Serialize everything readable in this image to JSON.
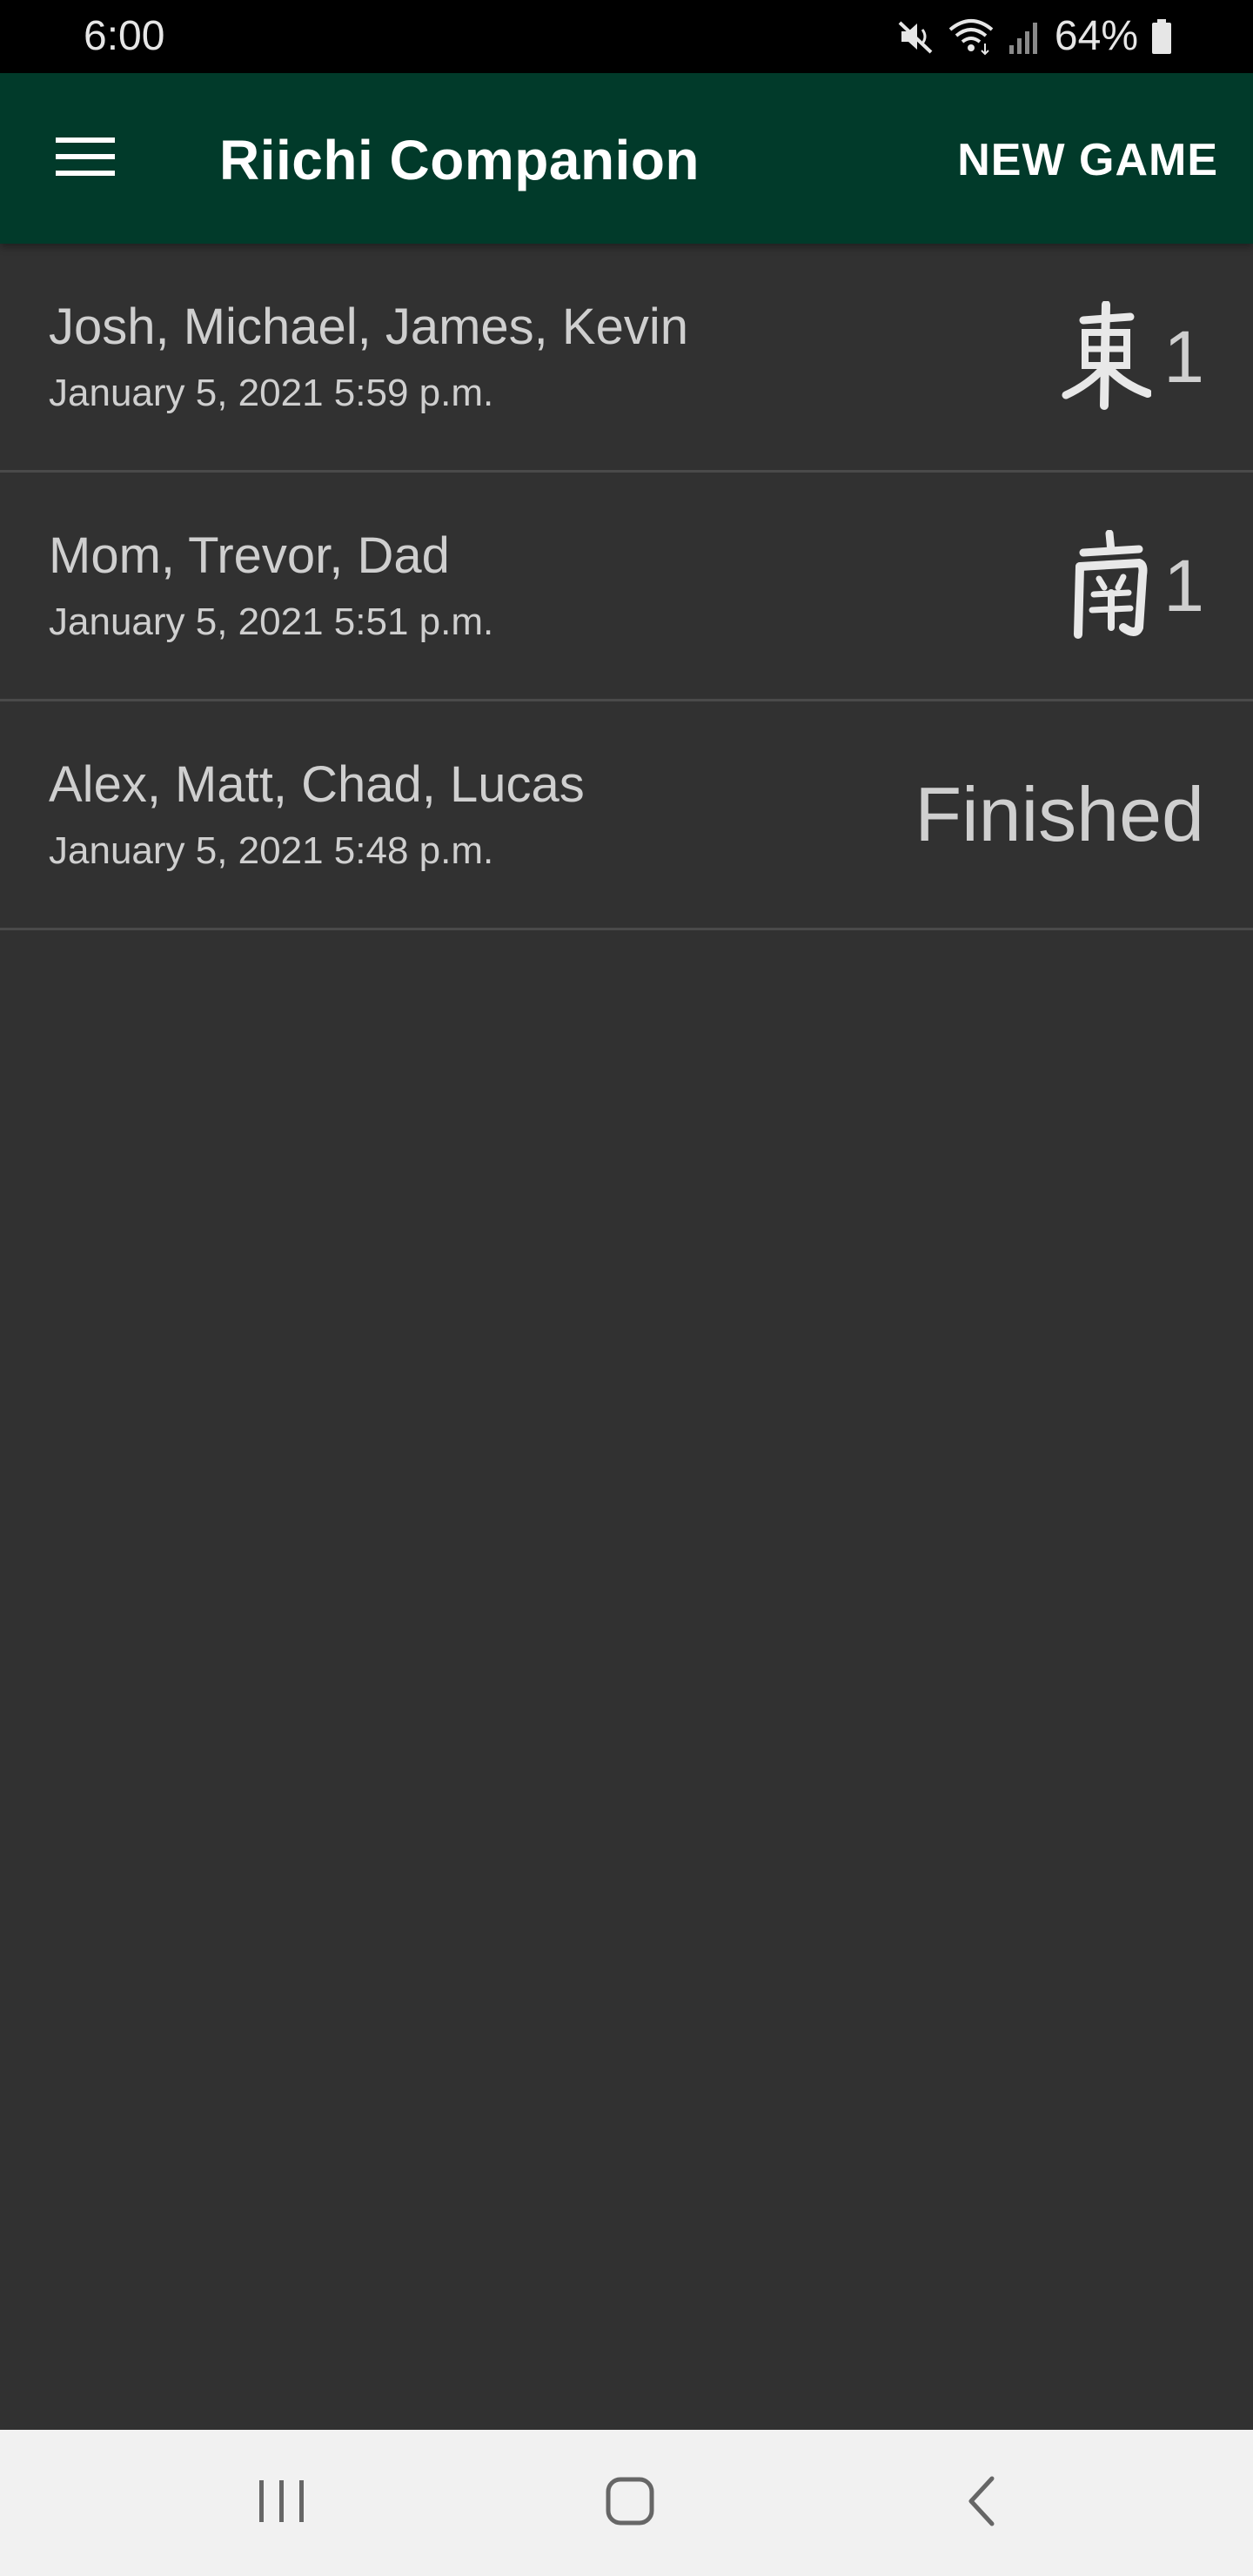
{
  "status_bar": {
    "time": "6:00",
    "battery": "64%",
    "icons": [
      "mute-icon",
      "wifi-icon",
      "signal-icon",
      "battery-icon"
    ]
  },
  "app_bar": {
    "menu_icon": "hamburger-menu-icon",
    "title": "Riichi Companion",
    "action_label": "NEW GAME",
    "background_color": "#013a2a"
  },
  "games": [
    {
      "players": "Josh, Michael, James, Kevin",
      "date": "January 5, 2021 5:59 p.m.",
      "wind_icon": "east-wind-icon",
      "round": "1"
    },
    {
      "players": "Mom, Trevor, Dad",
      "date": "January 5, 2021 5:51 p.m.",
      "wind_icon": "south-wind-icon",
      "round": "1"
    },
    {
      "players": "Alex, Matt, Chad, Lucas",
      "date": "January 5, 2021 5:48 p.m.",
      "status": "Finished"
    }
  ],
  "nav_bar": {
    "icons": [
      "recent-apps-icon",
      "home-icon",
      "back-icon"
    ]
  },
  "colors": {
    "background": "#313131",
    "text": "#cfcfcf",
    "divider": "#4a4a4a",
    "nav_bar": "#f1f1f1"
  }
}
